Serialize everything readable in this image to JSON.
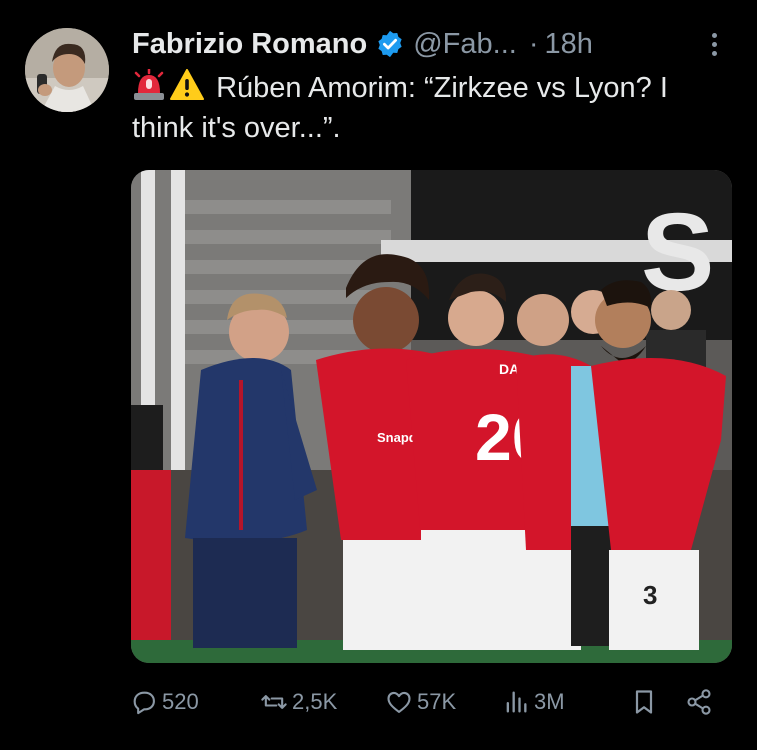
{
  "tweet": {
    "author_name": "Fabrizio Romano",
    "handle": "@Fab...",
    "separator": "·",
    "time": "18h",
    "text": "Rúben Amorim: “Zirkzee vs Lyon? I think it's over...”.",
    "emojis": [
      "rotating-light-emoji",
      "warning-emoji"
    ],
    "image": {
      "jersey_number_main": "20",
      "jersey_name": "DALOT",
      "sponsor_text": "Snapdragon",
      "shorts_number": "3",
      "banner_letter": "S"
    }
  },
  "actions": {
    "replies": "520",
    "reposts": "2,5K",
    "likes": "57K",
    "views": "3M"
  },
  "colors": {
    "background": "#000000",
    "text": "#e7e9ea",
    "muted": "#8b98a5",
    "verified": "#1d9bf0",
    "kit_red": "#d3152a"
  }
}
